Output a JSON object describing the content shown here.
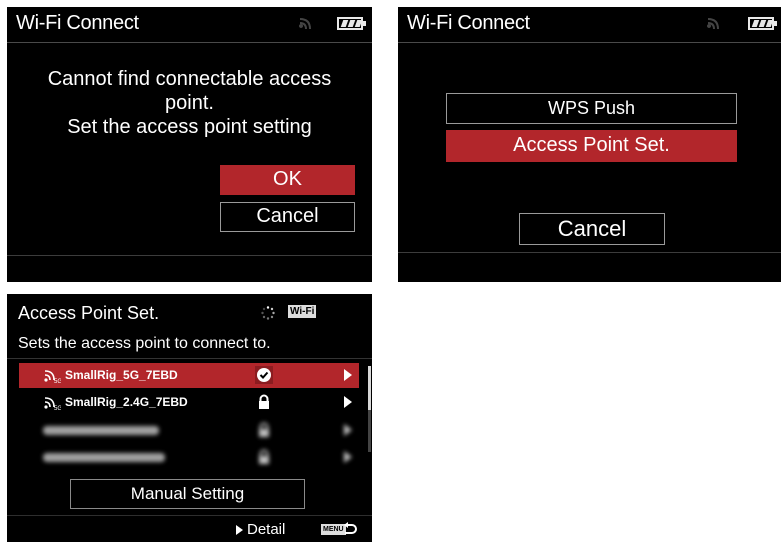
{
  "screens": {
    "error": {
      "title": "Wi-Fi Connect",
      "message_line1": "Cannot find connectable access",
      "message_line2": "point.",
      "message_line3": "Set the access point setting",
      "ok_label": "OK",
      "cancel_label": "Cancel"
    },
    "method": {
      "title": "Wi-Fi Connect",
      "wps_label": "WPS Push",
      "ap_set_label": "Access Point Set.",
      "cancel_label": "Cancel"
    },
    "ap_list": {
      "title": "Access Point Set.",
      "wifi_badge": "Wi-Fi",
      "subtitle": "Sets the access point to connect to.",
      "band_5g": "5G",
      "networks": [
        {
          "ssid": "SmallRig_5G_7EBD",
          "state_icon": "check-icon",
          "selected": true
        },
        {
          "ssid": "SmallRig_2.4G_7EBD",
          "state_icon": "lock-icon",
          "selected": false
        },
        {
          "ssid": "",
          "state_icon": "lock-icon",
          "selected": false
        },
        {
          "ssid": "",
          "state_icon": "lock-icon",
          "selected": false
        }
      ],
      "manual_label": "Manual Setting",
      "detail_label": "Detail",
      "menu_label": "MENU"
    }
  },
  "colors": {
    "selected": "#b2262b",
    "background": "#000000"
  }
}
